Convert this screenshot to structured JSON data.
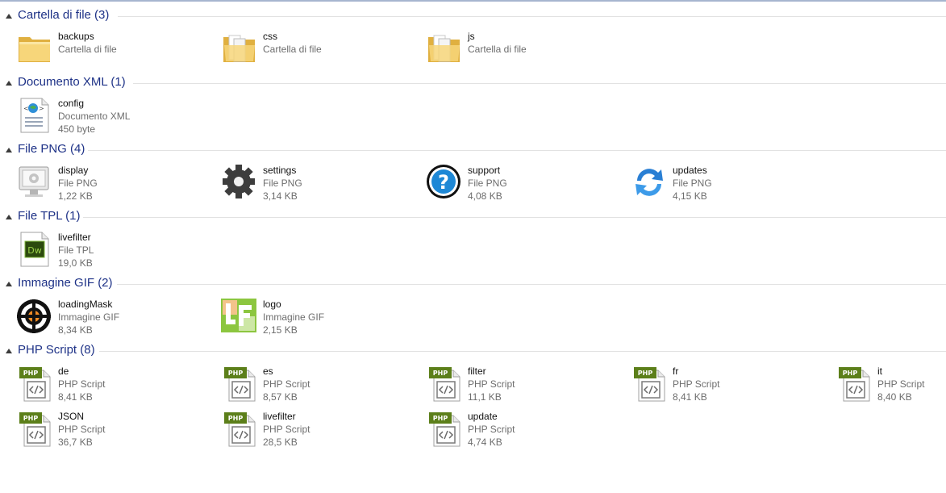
{
  "groups": [
    {
      "title": "Cartella di file (3)",
      "items": [
        {
          "name": "backups",
          "type": "Cartella di file",
          "size": "",
          "icon": "folder-empty-icon"
        },
        {
          "name": "css",
          "type": "Cartella di file",
          "size": "",
          "icon": "folder-icon"
        },
        {
          "name": "js",
          "type": "Cartella di file",
          "size": "",
          "icon": "folder-icon"
        }
      ]
    },
    {
      "title": "Documento XML (1)",
      "items": [
        {
          "name": "config",
          "type": "Documento XML",
          "size": "450 byte",
          "icon": "xml-document-icon"
        }
      ]
    },
    {
      "title": "File PNG (4)",
      "items": [
        {
          "name": "display",
          "type": "File PNG",
          "size": "1,22 KB",
          "icon": "display-icon"
        },
        {
          "name": "settings",
          "type": "File PNG",
          "size": "3,14 KB",
          "icon": "gear-icon"
        },
        {
          "name": "support",
          "type": "File PNG",
          "size": "4,08 KB",
          "icon": "help-icon"
        },
        {
          "name": "updates",
          "type": "File PNG",
          "size": "4,15 KB",
          "icon": "refresh-icon"
        }
      ]
    },
    {
      "title": "File TPL (1)",
      "items": [
        {
          "name": "livefilter",
          "type": "File TPL",
          "size": "19,0 KB",
          "icon": "dreamweaver-icon"
        }
      ]
    },
    {
      "title": "Immagine GIF (2)",
      "items": [
        {
          "name": "loadingMask",
          "type": "Immagine GIF",
          "size": "8,34 KB",
          "icon": "target-icon"
        },
        {
          "name": "logo",
          "type": "Immagine GIF",
          "size": "2,15 KB",
          "icon": "lf-logo-icon"
        }
      ]
    },
    {
      "title": "PHP Script (8)",
      "items": [
        {
          "name": "de",
          "type": "PHP Script",
          "size": "8,41 KB",
          "icon": "php-file-icon"
        },
        {
          "name": "es",
          "type": "PHP Script",
          "size": "8,57 KB",
          "icon": "php-file-icon"
        },
        {
          "name": "filter",
          "type": "PHP Script",
          "size": "11,1 KB",
          "icon": "php-file-icon"
        },
        {
          "name": "fr",
          "type": "PHP Script",
          "size": "8,41 KB",
          "icon": "php-file-icon"
        },
        {
          "name": "it",
          "type": "PHP Script",
          "size": "8,40 KB",
          "icon": "php-file-icon"
        },
        {
          "name": "JSON",
          "type": "PHP Script",
          "size": "36,7 KB",
          "icon": "php-file-icon"
        },
        {
          "name": "livefilter",
          "type": "PHP Script",
          "size": "28,5 KB",
          "icon": "php-file-icon"
        },
        {
          "name": "update",
          "type": "PHP Script",
          "size": "4,74 KB",
          "icon": "php-file-icon"
        }
      ]
    }
  ],
  "php_badge": "PHP",
  "dw_badge": "Dw",
  "colors": {
    "group_title": "#1e3287",
    "secondary_text": "#6d6d6d",
    "divider": "#e2e2e2",
    "folder": "#f2cf6b"
  }
}
